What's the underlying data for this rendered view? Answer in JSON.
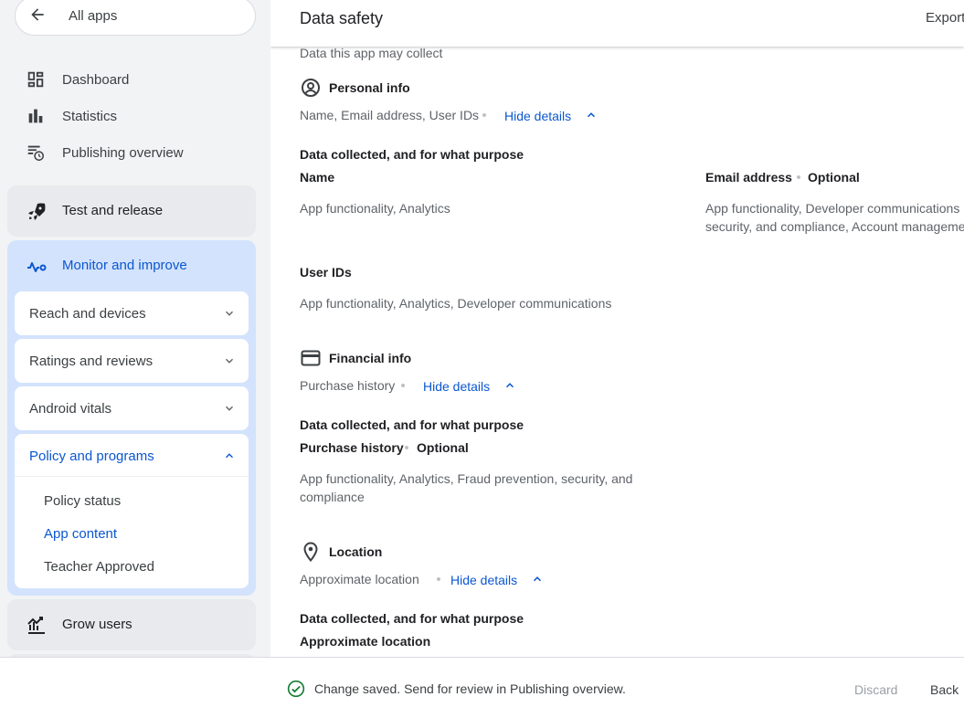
{
  "sidebar": {
    "all_apps": "All apps",
    "items": [
      {
        "label": "Dashboard",
        "icon": "dashboard-icon"
      },
      {
        "label": "Statistics",
        "icon": "bar-chart-icon"
      },
      {
        "label": "Publishing overview",
        "icon": "schedule-list-icon"
      }
    ],
    "test_release": "Test and release",
    "monitor_improve": "Monitor and improve",
    "sub_sections": [
      {
        "label": "Reach and devices"
      },
      {
        "label": "Ratings and reviews"
      },
      {
        "label": "Android vitals"
      }
    ],
    "policy": {
      "label": "Policy and programs",
      "links": [
        "Policy status",
        "App content",
        "Teacher Approved"
      ],
      "active_link": "App content"
    },
    "grow_users": "Grow users"
  },
  "header": {
    "title": "Data safety",
    "export": "Export"
  },
  "content": {
    "intro": "Data this app may collect",
    "hide_details": "Hide details",
    "collected_heading": "Data collected, and for what purpose",
    "optional": "Optional",
    "personal": {
      "title": "Personal info",
      "summary": "Name, Email address, User IDs",
      "name_label": "Name",
      "name_purpose": "App functionality, Analytics",
      "email_label": "Email address",
      "email_purpose_1": "App functionality, Developer communications",
      "email_purpose_2": "security, and compliance, Account management",
      "userids_label": "User IDs",
      "userids_purpose": "App functionality, Analytics, Developer communications"
    },
    "financial": {
      "title": "Financial info",
      "summary": "Purchase history",
      "item_label": "Purchase history",
      "purpose_1": "App functionality, Analytics, Fraud prevention, security, and",
      "purpose_2": "compliance"
    },
    "location": {
      "title": "Location",
      "summary": "Approximate location",
      "item_label": "Approximate location"
    }
  },
  "footer": {
    "message": "Change saved. Send for review in Publishing overview.",
    "discard": "Discard",
    "back": "Back"
  },
  "colors": {
    "accent": "#0b57d0",
    "active_section_bg": "#d3e3fd",
    "success": "#188038"
  }
}
